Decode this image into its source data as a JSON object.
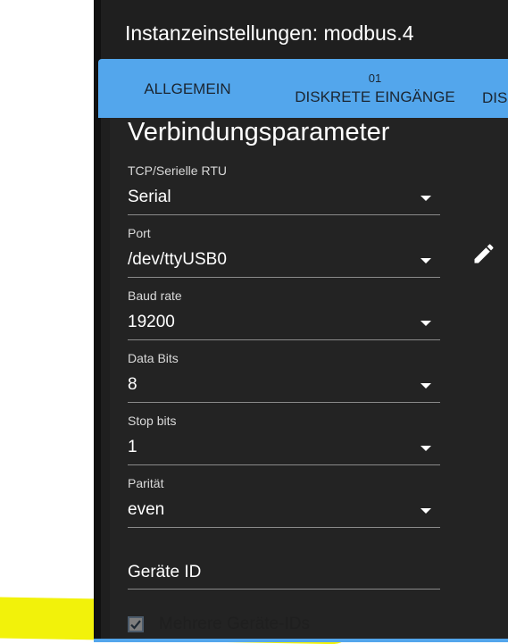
{
  "dialog": {
    "title": "Instanzeinstellungen: modbus.4"
  },
  "tabs": [
    {
      "number": "",
      "label": "ALLGEMEIN"
    },
    {
      "number": "01",
      "label": "DISKRETE EINGÄNGE"
    },
    {
      "number": "",
      "label": "DIS"
    }
  ],
  "section": {
    "title": "Verbindungsparameter"
  },
  "fields": [
    {
      "label": "TCP/Serielle RTU",
      "value": "Serial"
    },
    {
      "label": "Port",
      "value": "/dev/ttyUSB0"
    },
    {
      "label": "Baud rate",
      "value": "19200"
    },
    {
      "label": "Data Bits",
      "value": "8"
    },
    {
      "label": "Stop bits",
      "value": "1"
    },
    {
      "label": "Parität",
      "value": "even"
    }
  ],
  "device_id": {
    "placeholder": "Geräte ID"
  },
  "multi_ids": {
    "label": "Mehrere Geräte-IDs",
    "checked": true
  },
  "icons": {
    "edit": "pencil-icon",
    "dropdown": "triangle-down-icon",
    "checkbox": "check-icon"
  },
  "colors": {
    "accent": "#53a6ec",
    "highlight": "#f2f20a",
    "dialog_bg": "#1f1f1f"
  }
}
